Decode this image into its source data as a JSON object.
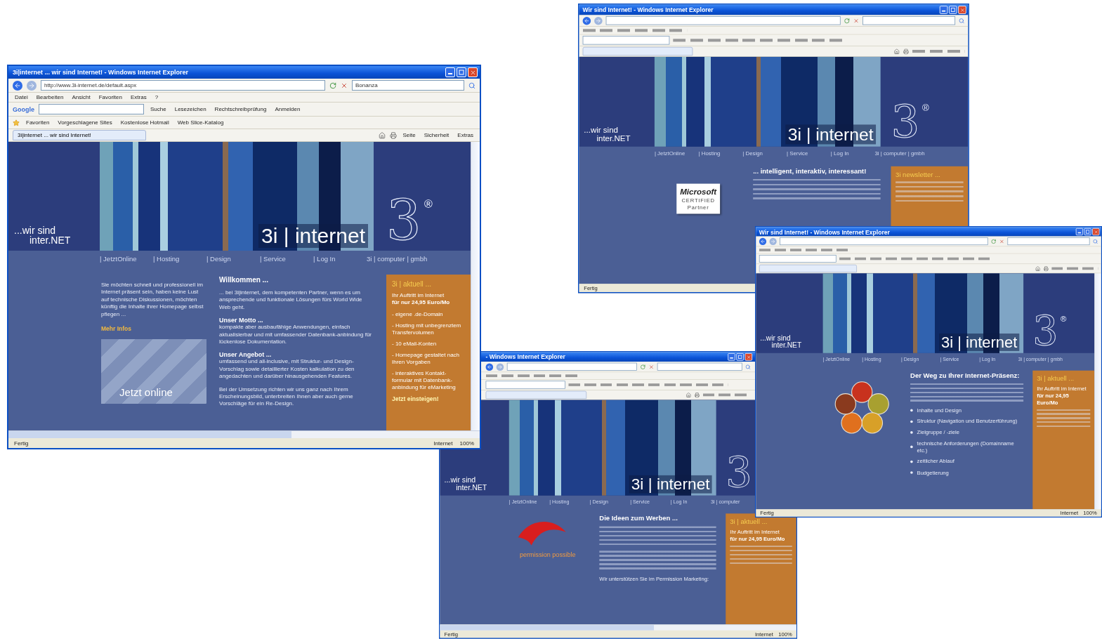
{
  "windows": [
    {
      "title": "3i|internet ... wir sind Internet! - Windows Internet Explorer",
      "address": "http://www.3i-internet.de/default.aspx",
      "search": "Bonanza",
      "menu": [
        "Datei",
        "Bearbeiten",
        "Ansicht",
        "Favoriten",
        "Extras",
        "?"
      ],
      "toolbar_label": "Google",
      "toolbar": [
        "Suche",
        "Lesezeichen",
        "Rechtschreibprüfung",
        "Anmelden"
      ],
      "favorites": [
        "Favoriten",
        "Vorgeschlagene Sites",
        "Kostenlose Hotmail",
        "Web Slice-Katalog"
      ],
      "tab": "3i|internet ... wir sind Internet!",
      "commands": [
        "Seite",
        "Sicherheit",
        "Extras"
      ],
      "page": {
        "tagline": [
          "...wir sind",
          "inter.NET"
        ],
        "brand": "3i | internet",
        "logo": "3",
        "logo_mark": "®",
        "nav": [
          "| JetztOnline",
          "| Hosting",
          "| Design",
          "| Service",
          "| Log In",
          "3i | computer | gmbh"
        ],
        "left": {
          "kind": "intro",
          "text": "Sie möchten schnell und professionell im Internet präsent sein, haben keine Lust auf technische Diskussionen, möchten künftig die Inhalte ihrer Homepage selbst pflegen ...",
          "link": "Mehr Infos",
          "photo_caption": "Jetzt online"
        },
        "heading": "Willkommen ...",
        "blocks": [
          {
            "kind": "text",
            "text": "... bei 3i|internet, dem kompetenten Partner, wenn es um ansprechende und funktionale Lösungen fürs World Wide Web geht."
          },
          {
            "kind": "text",
            "title": "Unser Motto ...",
            "text": "kompakte aber ausbaufähige Anwendungen, einfach aktualisierbar und mit umfassender Datenbank-anbindung für lückenlose Dokumentation."
          },
          {
            "kind": "text",
            "title": "Unser Angebot ...",
            "text": "umfassend und all-inclusive, mit Struktur- und Design-Vorschlag sowie detaillierter Kosten kalkulation zu den angedachten und darüber hinausgehenden Features."
          },
          {
            "kind": "text",
            "text": "Bei der Umsetzung richten wir uns ganz nach Ihrem Erscheinungsbild, unterbreiten Ihnen aber auch gerne Vorschläge für ein Re-Design."
          }
        ],
        "sidebar": {
          "heading": "3i | aktuell ...",
          "lines": [
            "Ihr Auftritt im Internet",
            "für nur 24,95 Euro/Mo"
          ],
          "items": [
            "- eigene .de-Domain",
            "- Hosting mit unbegrenztem Transfervolumen",
            "- 10 eMail-Konten",
            "- Homepage gestaltet nach Ihren Vorgaben",
            "- interaktives Kontakt-formular mit Datenbank-anbindung für eMarketing"
          ],
          "link": "Jetzt einsteigen!"
        }
      },
      "status": {
        "text": "Fertig",
        "zone": "Internet",
        "zoom": "100%"
      }
    },
    {
      "title": "Wir sind Internet! - Windows Internet Explorer",
      "page": {
        "tagline": [
          "...wir sind",
          "inter.NET"
        ],
        "brand": "3i | internet",
        "logo": "3",
        "logo_mark": "®",
        "nav": [
          "| JetztOnline",
          "| Hosting",
          "| Design",
          "| Service",
          "| Log In",
          "3i | computer | gmbh"
        ],
        "left": {
          "kind": "badge",
          "brand": "Microsoft",
          "level_text": "CERTIFIED",
          "role": "Partner"
        },
        "heading": "... intelligent, interaktiv, interessant!",
        "blocks": [
          {
            "kind": "blurred"
          }
        ],
        "sidebar": {
          "heading": "3i newsletter ..."
        }
      },
      "status": {
        "text": "Fertig"
      }
    },
    {
      "title": "- Windows Internet Explorer",
      "page": {
        "tagline": [
          "...wir sind",
          "inter.NET"
        ],
        "brand": "3i | internet",
        "logo": "3",
        "nav": [
          "| JetztOnline",
          "| Hosting",
          "| Design",
          "| Service",
          "| Log In",
          "3i | computer"
        ],
        "left": {
          "kind": "logo",
          "text": "permission possible"
        },
        "heading": "Die Ideen zum Werben ...",
        "blocks": [
          {
            "kind": "blurred"
          },
          {
            "kind": "blurred"
          },
          {
            "kind": "text",
            "text": "Wir unterstützen Sie im Permission Marketing:"
          }
        ],
        "sidebar": {
          "heading": "3i | aktuell ...",
          "lines": [
            "Ihr Auftritt im Internet",
            "für nur 24,95 Euro/Mo"
          ]
        }
      },
      "status": {
        "text": "Fertig",
        "zone": "Internet",
        "zoom": "100%"
      }
    },
    {
      "title": "Wir sind Internet! - Windows Internet Explorer",
      "page": {
        "tagline": [
          "...wir sind",
          "inter.NET"
        ],
        "brand": "3i | internet",
        "logo": "3",
        "logo_mark": "®",
        "nav": [
          "| JetztOnline",
          "| Hosting",
          "| Design",
          "| Service",
          "| Log In",
          "3i | computer | gmbh"
        ],
        "left": {
          "kind": "diagram"
        },
        "heading": "Der Weg zu Ihrer Internet-Präsenz:",
        "blocks": [
          {
            "kind": "blurred"
          }
        ],
        "bullets": [
          "Inhalte und Design",
          "Struktur (Navigation und Benutzerführung)",
          "Zielgruppe / -ziele",
          "technische Anforderungen (Domainname etc.)",
          "zeitlicher Ablauf",
          "Budgetierung"
        ],
        "sidebar": {
          "heading": "3i | aktuell ...",
          "lines": [
            "Ihr Auftritt im Internet",
            "für nur 24,95 Euro/Mo"
          ]
        }
      },
      "status": {
        "text": "Fertig",
        "zone": "Internet",
        "zoom": "100%"
      }
    }
  ]
}
